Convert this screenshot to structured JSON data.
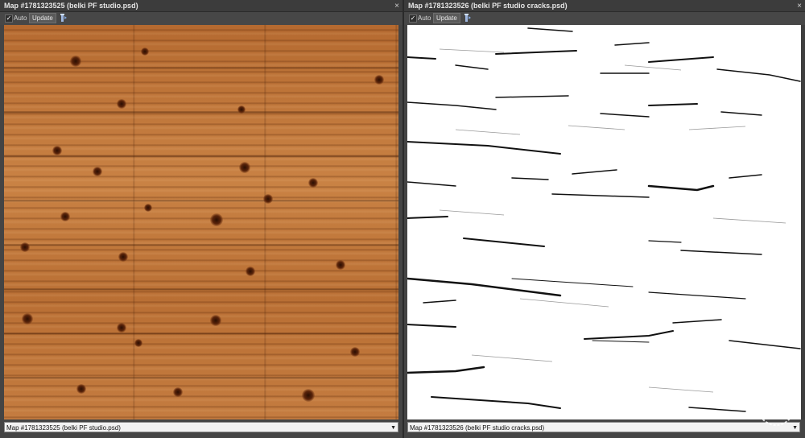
{
  "panels": [
    {
      "title": "Map #1781323525 (belki PF studio.psd)",
      "auto_label": "Auto",
      "update_label": "Update",
      "auto_checked": true,
      "dropdown_value": "Map #1781323525 (belki PF studio.psd)",
      "close_glyph": "×",
      "checkbox_glyph": "✓",
      "arrow_glyph": "▼"
    },
    {
      "title": "Map #1781323526 (belki PF studio cracks.psd)",
      "auto_label": "Auto",
      "update_label": "Update",
      "auto_checked": true,
      "dropdown_value": "Map #1781323526 (belki PF studio cracks.psd)",
      "close_glyph": "×",
      "checkbox_glyph": "✓",
      "arrow_glyph": "▼"
    }
  ],
  "watermark": {
    "text": "ABBS"
  },
  "icons": {
    "pin": "pin-icon",
    "close": "close-icon",
    "check": "check-icon",
    "arrow": "chevron-down-icon"
  },
  "colors": {
    "wood": "#c27638",
    "panel": "#444444",
    "title": "#3c3c3c"
  }
}
